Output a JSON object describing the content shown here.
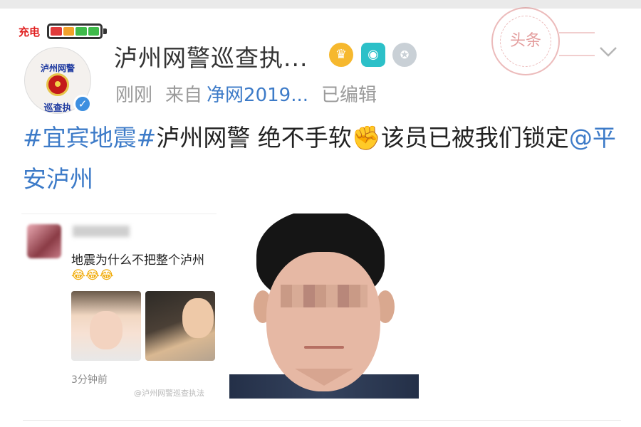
{
  "status": {
    "charging_label": "充电"
  },
  "author": {
    "name": "泸州网警巡查执...",
    "avatar_top_text": "泸州网警",
    "avatar_bottom_text": "巡查执",
    "verified_mark": "✓",
    "badges": [
      "crown-vip-icon",
      "camera-icon",
      "medal-icon"
    ]
  },
  "meta": {
    "time": "刚刚",
    "from_label": "来自",
    "source": "净网2019...",
    "edited": "已编辑"
  },
  "stamp_text": "头条",
  "post": {
    "tag1": "#宜宾地震#",
    "text1": "泸州网警 绝不手软",
    "emoji": "✊",
    "text2": "该员已被我们锁定",
    "mention": "@平安泸州"
  },
  "embedded_post": {
    "text": "地震为什么不把整个泸州",
    "emojis": "😂😂😂",
    "time": "3分钟前",
    "watermark": "@泸州网警巡查执法"
  },
  "colors": {
    "link": "#3d7bc8",
    "meta": "#9a9a9a",
    "battery": [
      "#e03a3a",
      "#f2a12a",
      "#3fba4a",
      "#3fba4a"
    ]
  }
}
